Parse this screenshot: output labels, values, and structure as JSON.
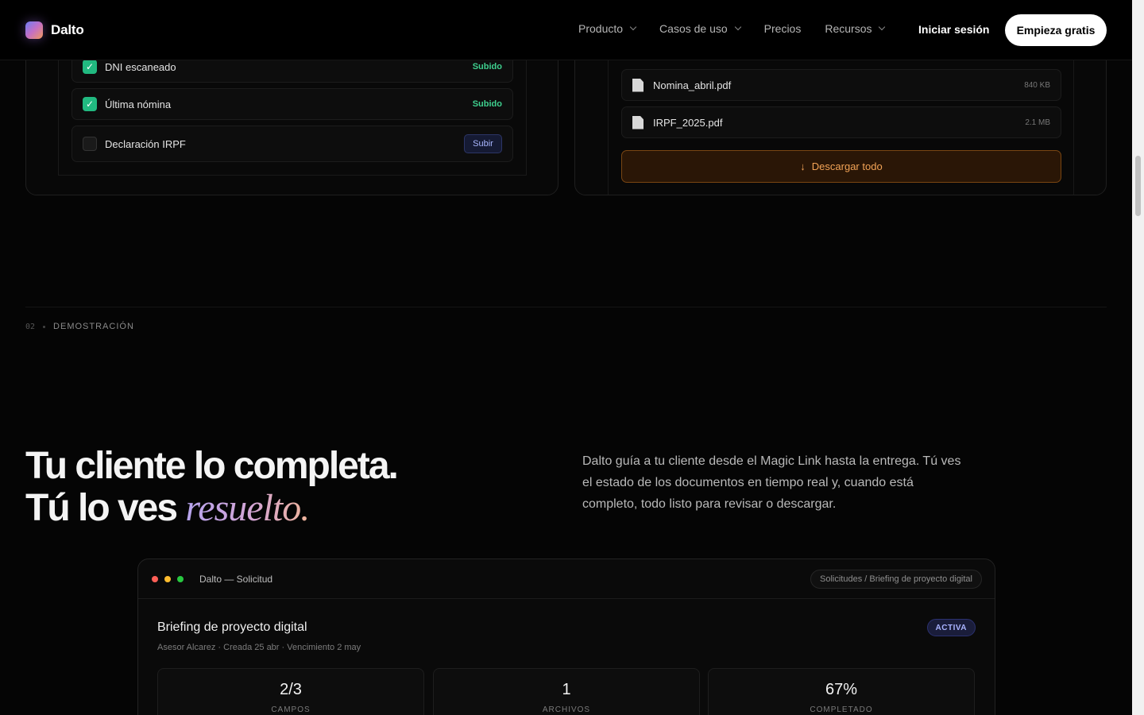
{
  "nav": {
    "brand": "Dalto",
    "menu": [
      {
        "label": "Producto",
        "has_dropdown": true
      },
      {
        "label": "Casos de uso",
        "has_dropdown": true
      },
      {
        "label": "Precios",
        "has_dropdown": false
      },
      {
        "label": "Recursos",
        "has_dropdown": true
      }
    ],
    "login": "Iniciar sesión",
    "cta": "Empieza gratis"
  },
  "checklist": [
    {
      "label": "DNI escaneado",
      "status": "Subido",
      "done": true
    },
    {
      "label": "Última nómina",
      "status": "Subido",
      "done": true
    },
    {
      "label": "Declaración IRPF",
      "action": "Subir",
      "done": false
    }
  ],
  "files": [
    {
      "name": "Nomina_abril.pdf",
      "size": "840 KB"
    },
    {
      "name": "IRPF_2025.pdf",
      "size": "2.1 MB"
    }
  ],
  "download_all": "Descargar todo",
  "section": {
    "number": "02",
    "label": "DEMOSTRACIÓN",
    "headline_line1": "Tu cliente lo completa.",
    "headline_line2_prefix": "Tú lo ves ",
    "headline_line2_emph": "resuelto.",
    "lead": "Dalto guía a tu cliente desde el Magic Link hasta la entrega. Tú ves el estado de los documentos en tiempo real y, cuando está completo, todo listo para revisar o descargar."
  },
  "demo": {
    "window_title": "Dalto — Solicitud",
    "breadcrumb": "Solicitudes / Briefing de proyecto digital",
    "request_title": "Briefing de proyecto digital",
    "meta": "Asesor Alcarez · Creada 25 abr · Vencimiento 2 may",
    "badge": "ACTIVA",
    "stats": [
      {
        "value": "2/3",
        "label": "CAMPOS"
      },
      {
        "value": "1",
        "label": "ARCHIVOS"
      },
      {
        "value": "67%",
        "label": "COMPLETADO"
      }
    ]
  },
  "colors": {
    "accent_green": "#21b980",
    "accent_orange": "#f2a356",
    "accent_indigo": "#aab4ff"
  }
}
